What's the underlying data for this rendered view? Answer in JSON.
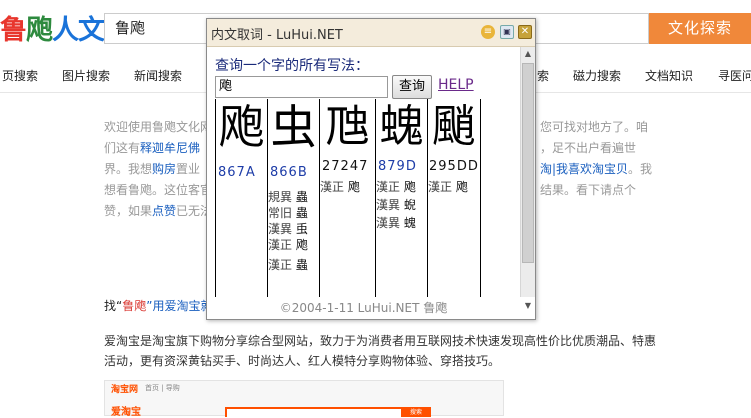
{
  "site": {
    "logo_parts": [
      "鲁",
      "飑",
      "人文"
    ],
    "search_value": "鲁飑",
    "search_button": "文化探索"
  },
  "nav": {
    "items": [
      "页搜索",
      "图片搜索",
      "新闻搜索",
      "索",
      "磁力搜索",
      "文档知识",
      "寻医问"
    ]
  },
  "article": {
    "line1_left": "欢迎使用鲁飑文化网",
    "line1_right": "您可找对地方了。咱",
    "line2_left": "们这有",
    "line2_blue": "释迦牟尼佛",
    "line2_right": "，足不出户看遍世",
    "line3_left": "界。我想",
    "line3_blue": "购房",
    "line3_mid": "置业",
    "line3_right_blue": "淘|我喜欢淘宝贝",
    "line3_right": "。我",
    "line4_left": "想看鲁飑。这位客官",
    "line4_right": "结果。看下请点个",
    "line5_left": "赞，如果",
    "line5_blue": "点赞",
    "line5_mid": "已无法",
    "shop_title_prefix": "找“",
    "shop_title_keyword": "鲁飑",
    "shop_title_suffix": "”用爱淘宝就",
    "shop_desc": "爱淘宝是淘宝旗下购物分享综合型网站，致力于为消费者用互联网技术快速发现高性价比优质潮品、特惠活动，更有资深黄钻买手、时尚达人、红人模特分享购物体验、穿搭技巧。"
  },
  "thumbnail": {
    "brand": "淘宝网",
    "brand2": "爱淘宝",
    "nav_text": "首页 | 导购",
    "search_btn": "搜索"
  },
  "popup": {
    "title": "内文取词 - LuHui.NET",
    "prompt": "查询一个字的所有写法：",
    "input_value": "飑",
    "query_button": "查询",
    "help_link": "HELP",
    "copyright": "©2004-1-11 LuHui.NET 鲁飑",
    "columns": [
      {
        "glyph": "飑",
        "code": "867A",
        "variants": []
      },
      {
        "glyph": "虫",
        "code": "866B",
        "variants": [
          {
            "label": "規異",
            "char": "蟲"
          },
          {
            "label": "常旧",
            "char": "蟲"
          },
          {
            "label": "漢異",
            "char": "䖝"
          },
          {
            "label": "漢正",
            "char": "飑"
          },
          {
            "label": "漢正",
            "char": "蟲"
          }
        ]
      },
      {
        "glyph": "虺",
        "code": "27247",
        "variants": [
          {
            "label": "漢正",
            "char": "飑"
          }
        ]
      },
      {
        "glyph": "螝",
        "code": "879D",
        "variants": [
          {
            "label": "漢正",
            "char": "飑"
          },
          {
            "label": "漢異",
            "char": "蜺"
          },
          {
            "label": "漢異",
            "char": "螝"
          }
        ]
      },
      {
        "glyph": "颵",
        "code": "295DD",
        "variants": [
          {
            "label": "漢正",
            "char": "飑"
          }
        ]
      }
    ]
  }
}
